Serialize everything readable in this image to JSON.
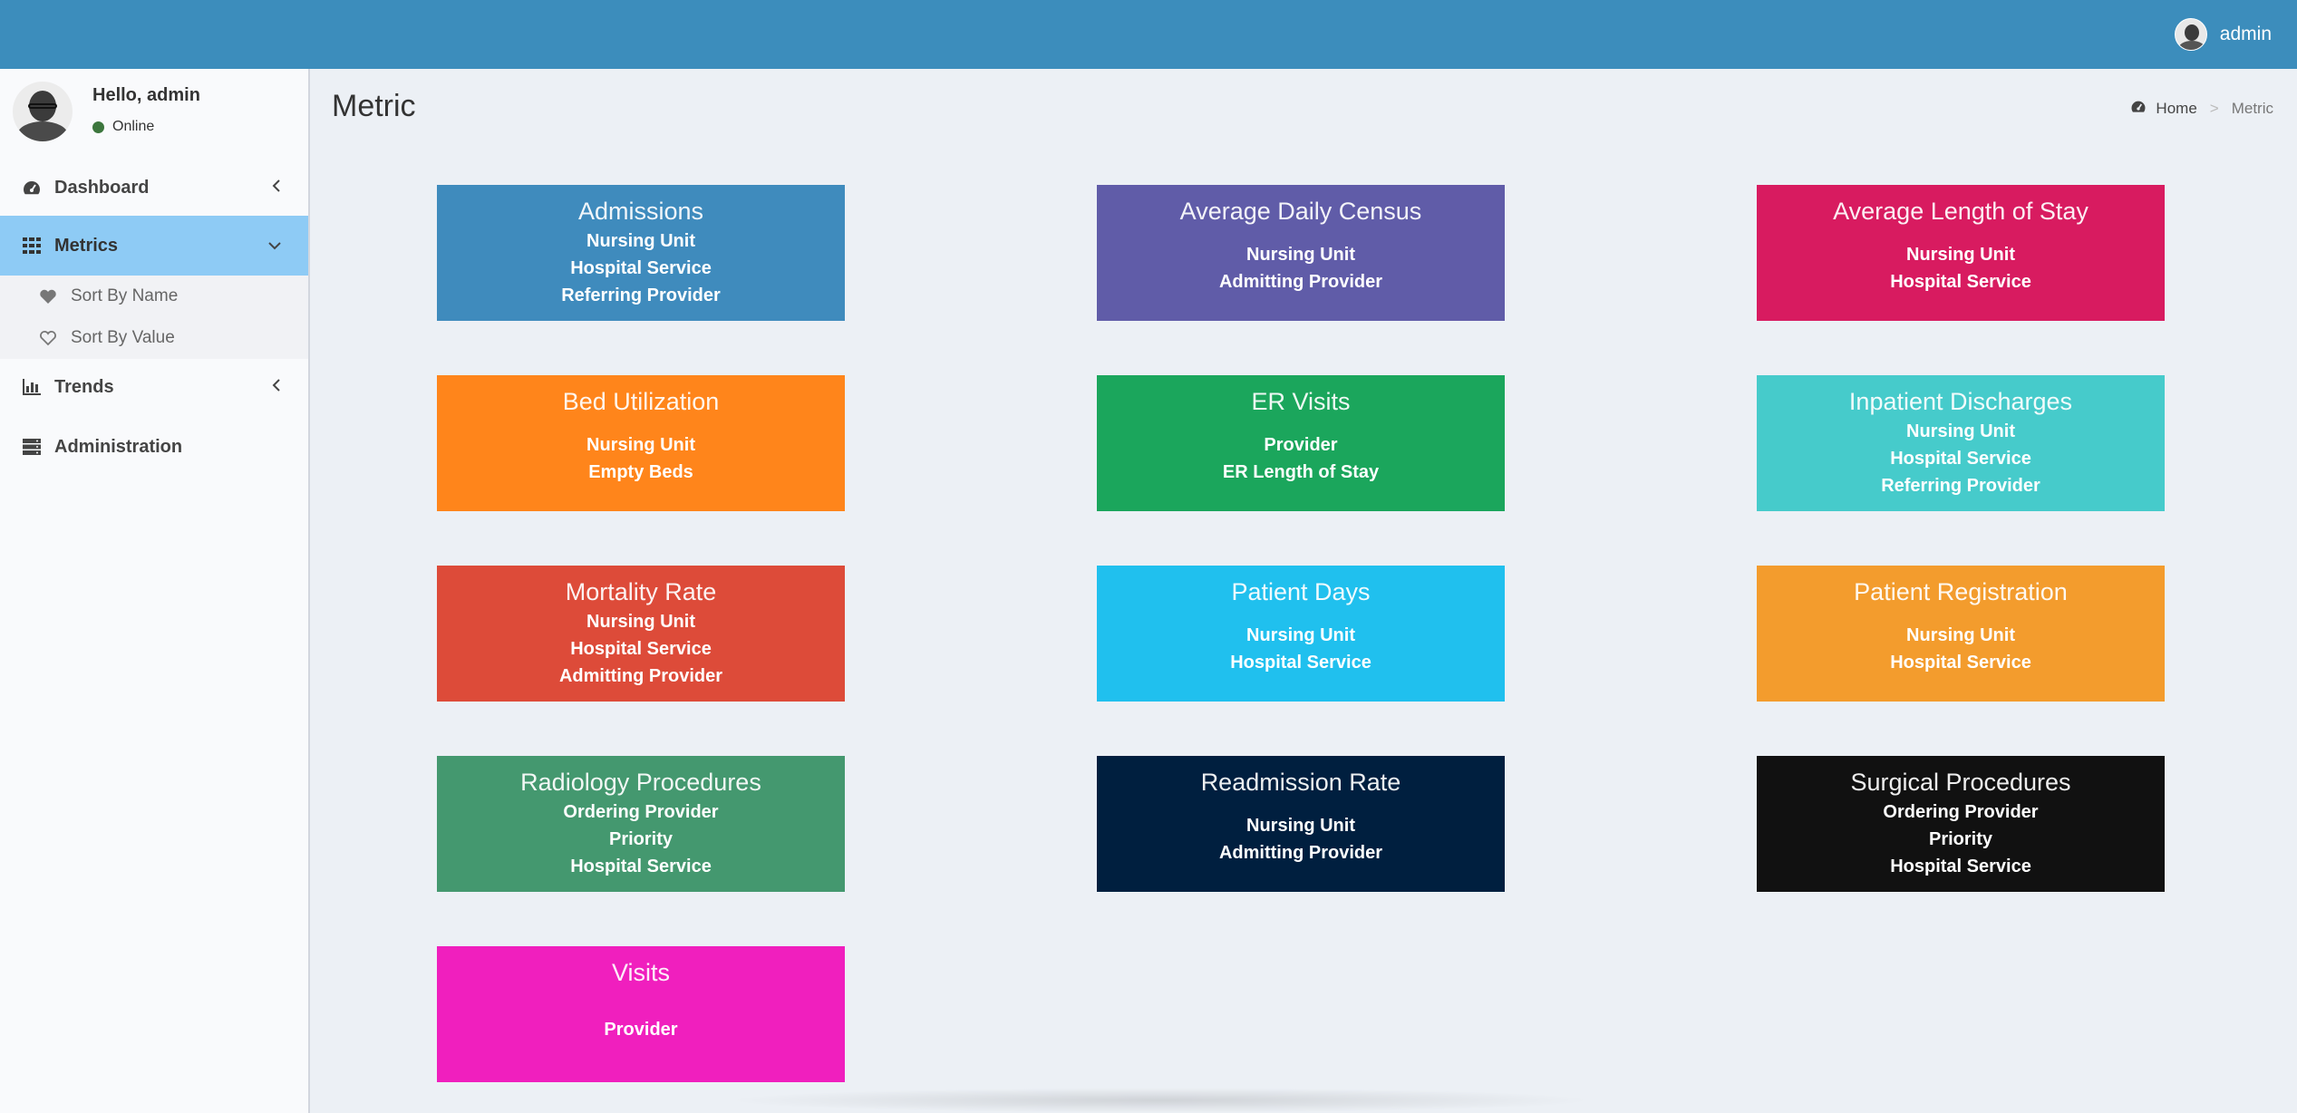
{
  "topbar": {
    "username": "admin"
  },
  "sidebar": {
    "greeting": "Hello, admin",
    "status": "Online",
    "items": [
      {
        "label": "Dashboard",
        "icon": "dashboard-icon"
      },
      {
        "label": "Metrics",
        "icon": "grid-icon",
        "active": true
      },
      {
        "label": "Trends",
        "icon": "bar-chart-icon"
      },
      {
        "label": "Administration",
        "icon": "server-icon"
      }
    ],
    "submenu": [
      {
        "label": "Sort By Name",
        "icon": "heart-icon"
      },
      {
        "label": "Sort By Value",
        "icon": "heart-outline-icon"
      }
    ]
  },
  "page": {
    "title": "Metric"
  },
  "breadcrumb": {
    "home": "Home",
    "current": "Metric"
  },
  "tiles": [
    {
      "title": "Admissions",
      "color": "#3f8bbd",
      "lines": [
        "Nursing Unit",
        "Hospital Service",
        "Referring Provider"
      ]
    },
    {
      "title": "Average Daily Census",
      "color": "#605ca8",
      "lines": [
        "Nursing Unit",
        "Admitting Provider"
      ]
    },
    {
      "title": "Average Length of Stay",
      "color": "#d81b60",
      "lines": [
        "Nursing Unit",
        "Hospital Service"
      ]
    },
    {
      "title": "Bed Utilization",
      "color": "#ff851b",
      "lines": [
        "Nursing Unit",
        "Empty Beds"
      ]
    },
    {
      "title": "ER Visits",
      "color": "#1ba65c",
      "lines": [
        "Provider",
        "ER Length of Stay"
      ]
    },
    {
      "title": "Inpatient Discharges",
      "color": "#46cbcb",
      "lines": [
        "Nursing Unit",
        "Hospital Service",
        "Referring Provider"
      ]
    },
    {
      "title": "Mortality Rate",
      "color": "#dd4b39",
      "lines": [
        "Nursing Unit",
        "Hospital Service",
        "Admitting Provider"
      ]
    },
    {
      "title": "Patient Days",
      "color": "#20c0ee",
      "lines": [
        "Nursing Unit",
        "Hospital Service"
      ]
    },
    {
      "title": "Patient Registration",
      "color": "#f39c2d",
      "lines": [
        "Nursing Unit",
        "Hospital Service"
      ]
    },
    {
      "title": "Radiology Procedures",
      "color": "#44986f",
      "lines": [
        "Ordering Provider",
        "Priority",
        "Hospital Service"
      ]
    },
    {
      "title": "Readmission Rate",
      "color": "#001f3f",
      "lines": [
        "Nursing Unit",
        "Admitting Provider"
      ]
    },
    {
      "title": "Surgical Procedures",
      "color": "#111111",
      "lines": [
        "Ordering Provider",
        "Priority",
        "Hospital Service"
      ]
    },
    {
      "title": "Visits",
      "color": "#f01fbe",
      "lines": [
        "Provider"
      ]
    }
  ]
}
